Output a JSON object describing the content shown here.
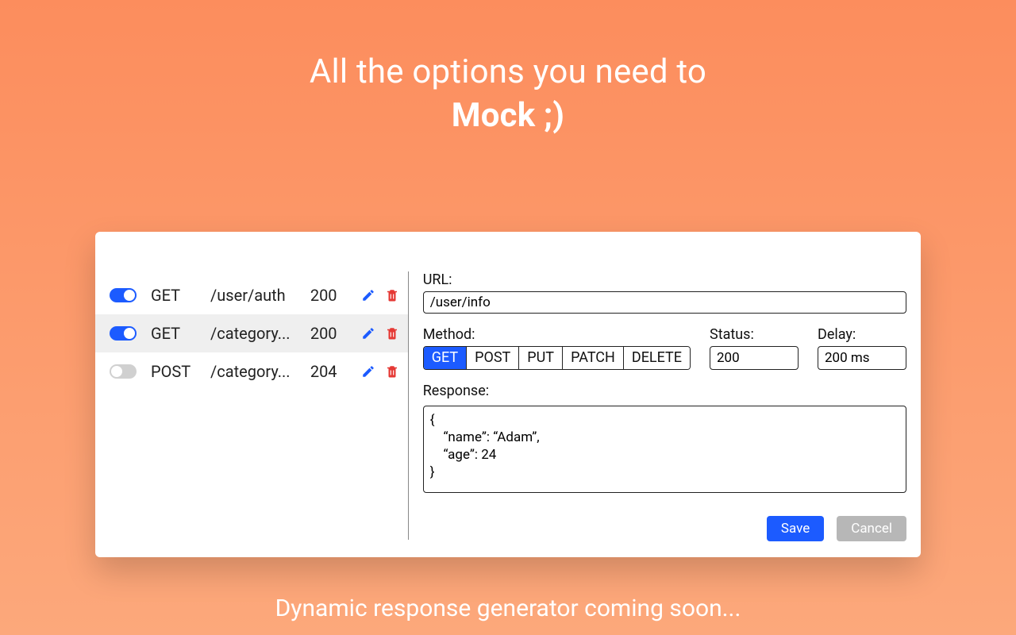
{
  "hero": {
    "line1": "All the options you need to",
    "line2": "Mock ;)"
  },
  "mocks": [
    {
      "enabled": true,
      "method": "GET",
      "path": "/user/auth",
      "status": "200",
      "selected": false
    },
    {
      "enabled": true,
      "method": "GET",
      "path": "/category...",
      "status": "200",
      "selected": true
    },
    {
      "enabled": false,
      "method": "POST",
      "path": "/category...",
      "status": "204",
      "selected": false
    }
  ],
  "form": {
    "url_label": "URL:",
    "url_value": "/user/info",
    "method_label": "Method:",
    "methods": [
      "GET",
      "POST",
      "PUT",
      "PATCH",
      "DELETE"
    ],
    "method_selected": "GET",
    "status_label": "Status:",
    "status_value": "200",
    "delay_label": "Delay:",
    "delay_value": "200 ms",
    "response_label": "Response:",
    "response_value": "{\n    “name”: “Adam”,\n    “age”: 24\n}",
    "save_label": "Save",
    "cancel_label": "Cancel"
  },
  "footer": "Dynamic response generator coming soon..."
}
